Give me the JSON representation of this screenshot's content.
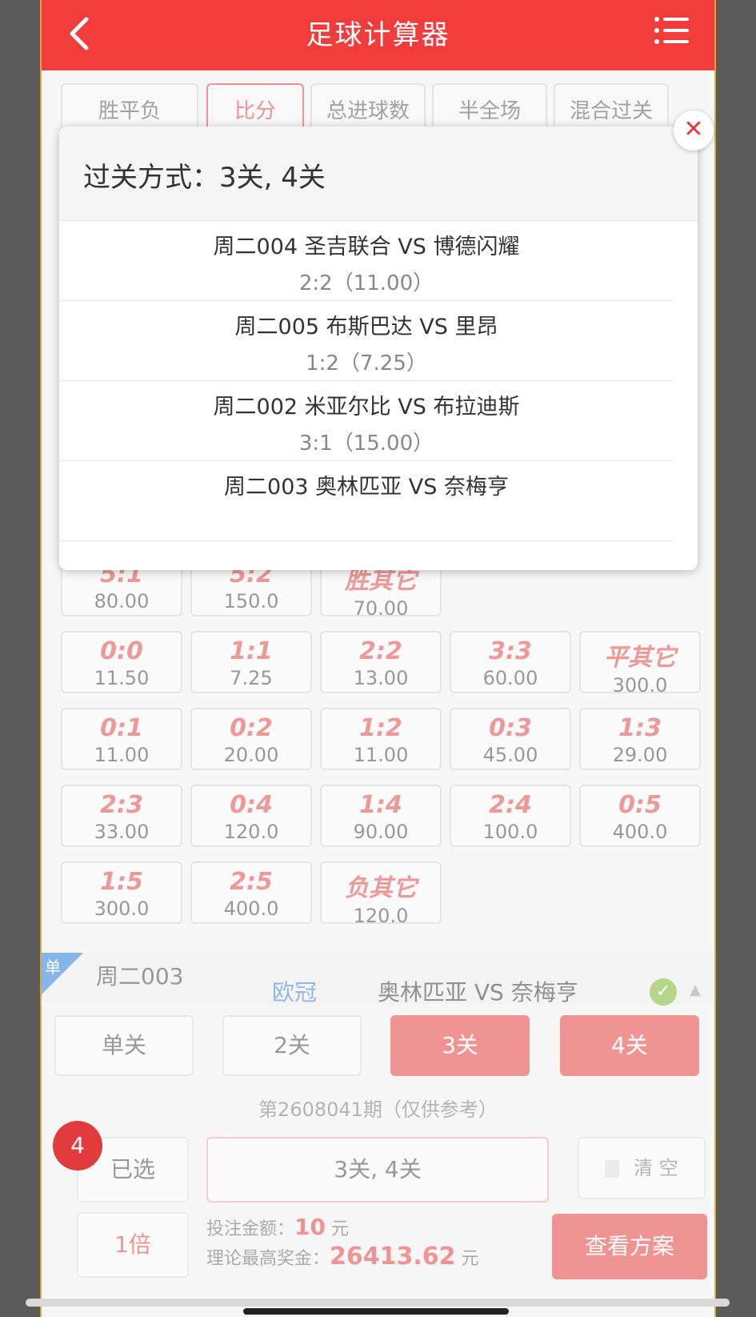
{
  "header": {
    "title": "足球计算器"
  },
  "tabs": [
    {
      "label": "胜平负",
      "active": false
    },
    {
      "label": "比分",
      "active": true
    },
    {
      "label": "总进球数",
      "active": false
    },
    {
      "label": "半全场",
      "active": false
    },
    {
      "label": "混合过关",
      "active": false
    }
  ],
  "grid": [
    {
      "score": "5:1",
      "odds": "80.00"
    },
    {
      "score": "5:2",
      "odds": "150.0"
    },
    {
      "score": "胜其它",
      "odds": "70.00"
    },
    {
      "score": "0:0",
      "odds": "11.50"
    },
    {
      "score": "1:1",
      "odds": "7.25"
    },
    {
      "score": "2:2",
      "odds": "13.00"
    },
    {
      "score": "3:3",
      "odds": "60.00"
    },
    {
      "score": "平其它",
      "odds": "300.0"
    },
    {
      "score": "0:1",
      "odds": "11.00"
    },
    {
      "score": "0:2",
      "odds": "20.00"
    },
    {
      "score": "1:2",
      "odds": "11.00"
    },
    {
      "score": "0:3",
      "odds": "45.00"
    },
    {
      "score": "1:3",
      "odds": "29.00"
    },
    {
      "score": "2:3",
      "odds": "33.00"
    },
    {
      "score": "0:4",
      "odds": "120.0"
    },
    {
      "score": "1:4",
      "odds": "90.00"
    },
    {
      "score": "2:4",
      "odds": "100.0"
    },
    {
      "score": "0:5",
      "odds": "400.0"
    },
    {
      "score": "1:5",
      "odds": "300.0"
    },
    {
      "score": "2:5",
      "odds": "400.0"
    },
    {
      "score": "负其它",
      "odds": "120.0"
    }
  ],
  "match": {
    "badge": "单",
    "day": "周二003",
    "league": "欧冠",
    "teams": "奥林匹亚 VS 奈梅亨"
  },
  "pass_buttons": [
    {
      "label": "单关",
      "selected": false
    },
    {
      "label": "2关",
      "selected": false
    },
    {
      "label": "3关",
      "selected": true
    },
    {
      "label": "4关",
      "selected": true
    }
  ],
  "period": "第2608041期（仅供参考）",
  "bottom": {
    "count": "4",
    "selected_label": "已选",
    "multiplier": "1倍",
    "summary": "3关, 4关",
    "clear_label": "清 空",
    "bet_amount_label": "投注金额：",
    "bet_amount": "10",
    "unit": "元",
    "max_prize_label": "理论最高奖金：",
    "max_prize": "26413.62",
    "view_button": "查看方案"
  },
  "modal": {
    "title": "过关方式：3关, 4关",
    "items": [
      {
        "teams": "周二004 圣吉联合 VS 博德闪耀",
        "pick": "2:2（11.00）"
      },
      {
        "teams": "周二005 布斯巴达 VS 里昂",
        "pick": "1:2（7.25）"
      },
      {
        "teams": "周二002 米亚尔比 VS 布拉迪斯",
        "pick": "3:1（15.00）"
      },
      {
        "teams": "周二003 奥林匹亚 VS 奈梅亨",
        "pick": ""
      }
    ]
  },
  "colors": {
    "brand_red": "#f23b3b",
    "accent_blue": "#3a7bd5"
  }
}
